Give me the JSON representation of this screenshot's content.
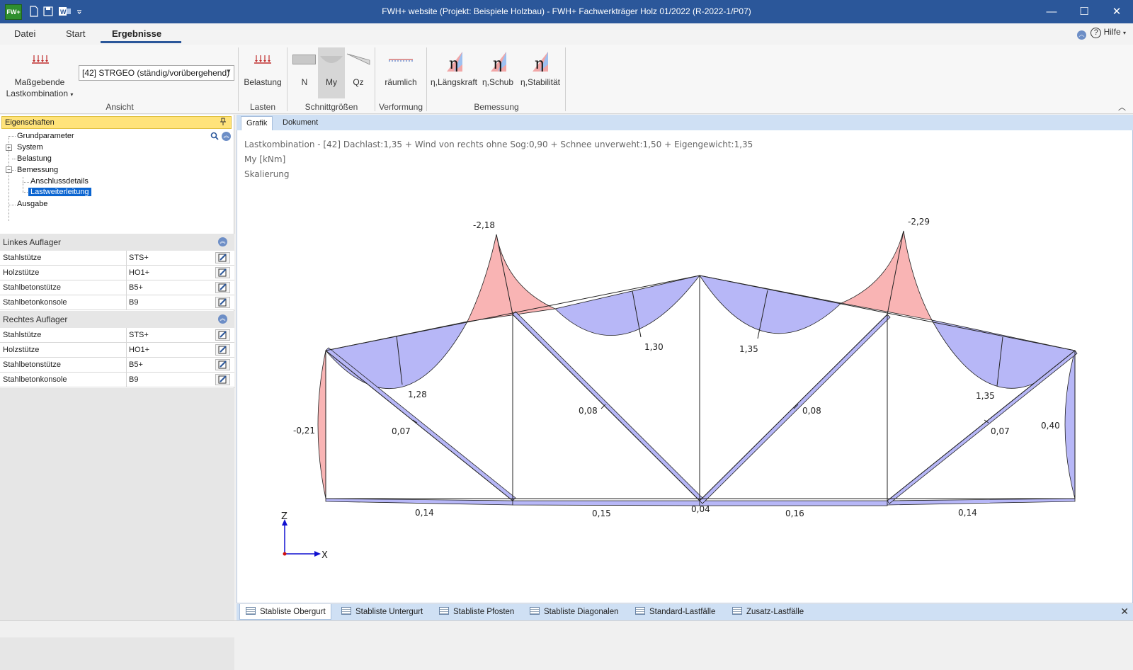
{
  "window": {
    "app_icon_text": "FW+",
    "title": "FWH+ website (Projekt: Beispiele Holzbau) - FWH+ Fachwerkträger Holz 01/2022 (R-2022-1/P07)",
    "minimize": "—",
    "maximize": "☐",
    "close": "✕"
  },
  "ribbon_tabs": [
    "Datei",
    "Start",
    "Ergebnisse"
  ],
  "help": {
    "label": "Hilfe",
    "caret": "▾"
  },
  "ribbon": {
    "ansicht": {
      "button_line1": "Maßgebende",
      "button_line2": "Lastkombination",
      "caret": "▾",
      "combo_value": "[42] STRGEO (ständig/vorübergehend)",
      "combo_arrow": "▼",
      "group_label": "Ansicht"
    },
    "lasten": {
      "button": "Belastung",
      "group_label": "Lasten"
    },
    "schnittgroessen": {
      "buttons": [
        "N",
        "My",
        "Qz"
      ],
      "group_label": "Schnittgrößen"
    },
    "verformung": {
      "button": "räumlich",
      "group_label": "Verformung"
    },
    "bemessung": {
      "buttons": [
        "η,Längskraft",
        "η,Schub",
        "η,Stabilität"
      ],
      "group_label": "Bemessung"
    },
    "collapse": "︿"
  },
  "left_panel": {
    "header": "Eigenschaften",
    "pin": "📌",
    "tree": [
      "Grundparameter",
      "System",
      "Belastung",
      "Bemessung",
      "Anschlussdetails",
      "Lastweiterleitung",
      "Ausgabe"
    ],
    "sections": [
      {
        "title": "Linkes Auflager",
        "rows": [
          {
            "name": "Stahlstütze",
            "value": "STS+"
          },
          {
            "name": "Holzstütze",
            "value": "HO1+"
          },
          {
            "name": "Stahlbetonstütze",
            "value": "B5+"
          },
          {
            "name": "Stahlbetonkonsole",
            "value": "B9"
          }
        ]
      },
      {
        "title": "Rechtes Auflager",
        "rows": [
          {
            "name": "Stahlstütze",
            "value": "STS+"
          },
          {
            "name": "Holzstütze",
            "value": "HO1+"
          },
          {
            "name": "Stahlbetonstütze",
            "value": "B5+"
          },
          {
            "name": "Stahlbetonkonsole",
            "value": "B9"
          }
        ]
      }
    ]
  },
  "content_tabs": [
    "Grafik",
    "Dokument"
  ],
  "info": {
    "line1": "Lastkombination - [42] Dachlast:1,35 + Wind von rechts ohne Sog:0,90 + Schnee unverweht:1,50 + Eigengewicht:1,35",
    "line2": "My [kNm]",
    "line3": "Skalierung"
  },
  "diagram": {
    "labels": {
      "top_left": "-2,18",
      "top_right": "-2,29",
      "left_span": "1,28",
      "mid_left": "1,30",
      "mid_right": "1,35",
      "right_span": "1,35",
      "left_post": "-0,21",
      "right_post": "0,40",
      "diag1": "0,07",
      "diag2": "0,08",
      "diag3": "0,08",
      "diag4": "0,07",
      "bot1": "0,14",
      "bot2": "0,15",
      "bot3": "0,04",
      "bot4": "0,16",
      "bot5": "0,14"
    },
    "axis": {
      "z": "Z",
      "x": "X"
    },
    "colors": {
      "negative": "#f9b4b4",
      "positive": "#b7b7f7",
      "outline": "#222222"
    }
  },
  "bottom_tabs": [
    "Stabliste Obergurt",
    "Stabliste Untergurt",
    "Stabliste Pfosten",
    "Stabliste Diagonalen",
    "Standard-Lastfälle",
    "Zusatz-Lastfälle"
  ],
  "bottom_close": "✕"
}
